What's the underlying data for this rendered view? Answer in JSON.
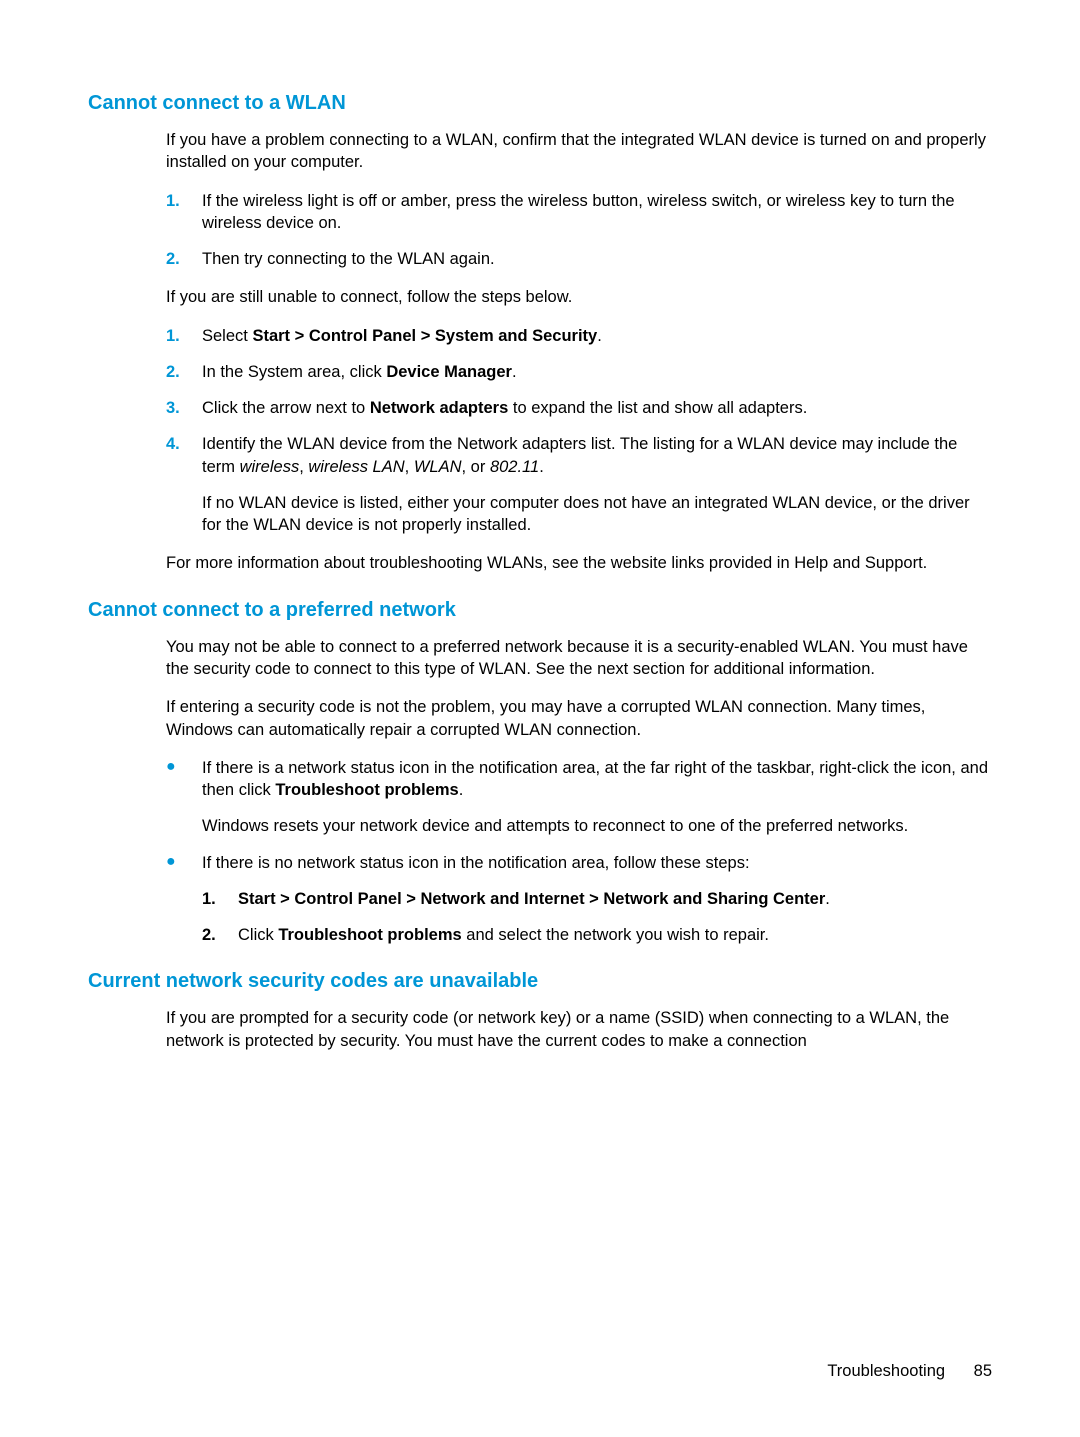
{
  "section1": {
    "heading": "Cannot connect to a WLAN",
    "intro": "If you have a problem connecting to a WLAN, confirm that the integrated WLAN device is turned on and properly installed on your computer.",
    "list1": {
      "n1": "1.",
      "t1": "If the wireless light is off or amber, press the wireless button, wireless switch, or wireless key to turn the wireless device on.",
      "n2": "2.",
      "t2": "Then try connecting to the WLAN again."
    },
    "mid": "If you are still unable to connect, follow the steps below.",
    "list2": {
      "n1": "1.",
      "t1a": "Select ",
      "t1b": "Start > Control Panel > System and Security",
      "t1c": ".",
      "n2": "2.",
      "t2a": "In the System area, click ",
      "t2b": "Device Manager",
      "t2c": ".",
      "n3": "3.",
      "t3a": "Click the arrow next to ",
      "t3b": "Network adapters",
      "t3c": " to expand the list and show all adapters.",
      "n4": "4.",
      "t4a": "Identify the WLAN device from the Network adapters list. The listing for a WLAN device may include the term ",
      "t4b": "wireless",
      "t4c": ", ",
      "t4d": "wireless LAN",
      "t4e": ", ",
      "t4f": "WLAN",
      "t4g": ", or ",
      "t4h": "802.11",
      "t4i": ".",
      "t4sub": "If no WLAN device is listed, either your computer does not have an integrated WLAN device, or the driver for the WLAN device is not properly installed."
    },
    "outro": "For more information about troubleshooting WLANs, see the website links provided in Help and Support."
  },
  "section2": {
    "heading": "Cannot connect to a preferred network",
    "p1": "You may not be able to connect to a preferred network because it is a security-enabled WLAN. You must have the security code to connect to this type of WLAN. See the next section for additional information.",
    "p2": "If entering a security code is not the problem, you may have a corrupted WLAN connection. Many times, Windows can automatically repair a corrupted WLAN connection.",
    "bullet1": {
      "dot": "●",
      "t1a": "If there is a network status icon in the notification area, at the far right of the taskbar, right-click the icon, and then click ",
      "t1b": "Troubleshoot problems",
      "t1c": ".",
      "sub": "Windows resets your network device and attempts to reconnect to one of the preferred networks."
    },
    "bullet2": {
      "dot": "●",
      "t": "If there is no network status icon in the notification area, follow these steps:",
      "list": {
        "n1": "1.",
        "t1a": "Start > Control Panel > Network and Internet > Network and Sharing Center",
        "t1b": ".",
        "n2": "2.",
        "t2a": "Click ",
        "t2b": "Troubleshoot problems",
        "t2c": " and select the network you wish to repair."
      }
    }
  },
  "section3": {
    "heading": "Current network security codes are unavailable",
    "p1": "If you are prompted for a security code (or network key) or a name (SSID) when connecting to a WLAN, the network is protected by security. You must have the current codes to make a connection"
  },
  "footer": {
    "label": "Troubleshooting",
    "page": "85"
  }
}
